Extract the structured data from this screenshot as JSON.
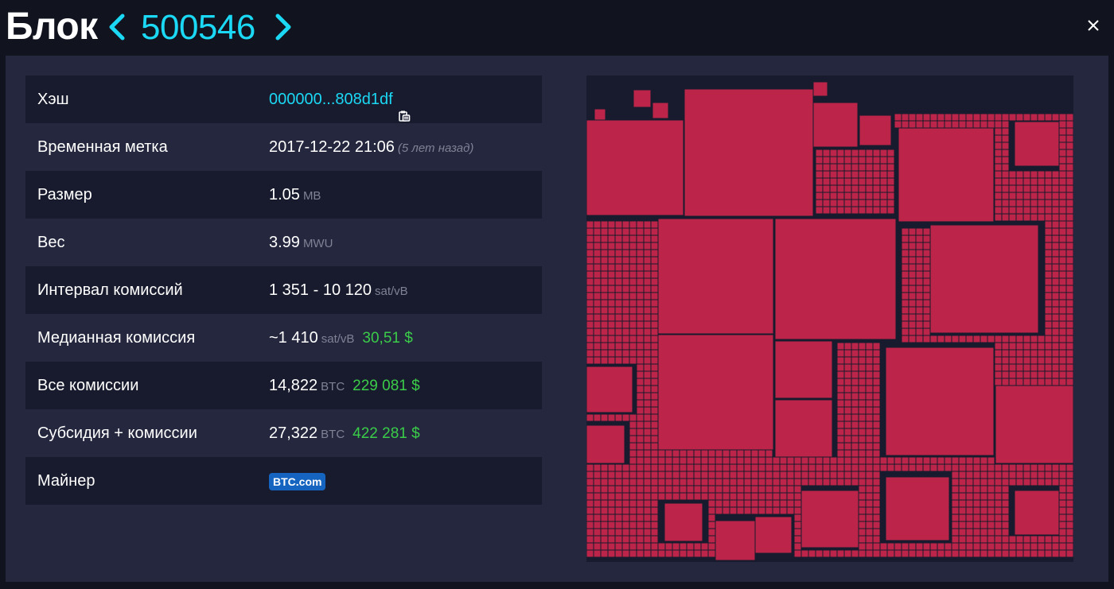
{
  "header": {
    "title": "Блок",
    "height": "500546"
  },
  "details": {
    "hash_label": "Хэш",
    "hash_value": "000000...808d1df",
    "timestamp_label": "Временная метка",
    "timestamp_value": "2017-12-22 21:06",
    "timestamp_relative": "(5 лет назад)",
    "size_label": "Размер",
    "size_value": "1.05",
    "size_unit": "MB",
    "weight_label": "Вес",
    "weight_value": "3.99",
    "weight_unit": "MWU",
    "fee_span_label": "Интервал комиссий",
    "fee_span_value": "1 351 - 10 120",
    "fee_span_unit": "sat/vB",
    "median_fee_label": "Медианная комиссия",
    "median_fee_value": "~1 410",
    "median_fee_unit": "sat/vB",
    "median_fee_fiat": "30,51 $",
    "total_fees_label": "Все комиссии",
    "total_fees_value": "14,822",
    "total_fees_unit": "BTC",
    "total_fees_fiat": "229 081 $",
    "subsidy_label": "Субсидия + комиссии",
    "subsidy_value": "27,322",
    "subsidy_unit": "BTC",
    "subsidy_fiat": "422 281 $",
    "miner_label": "Майнер",
    "miner_value": "BTC.com"
  },
  "icons": {
    "prev": "chevron-left-icon",
    "next": "chevron-right-icon",
    "close": "close-icon",
    "copy": "clipboard-icon"
  },
  "colors": {
    "accent": "#1bd8f4",
    "fiat": "#3bcc49",
    "tx_block": "#bc2449",
    "pool_badge": "#1565c0"
  }
}
